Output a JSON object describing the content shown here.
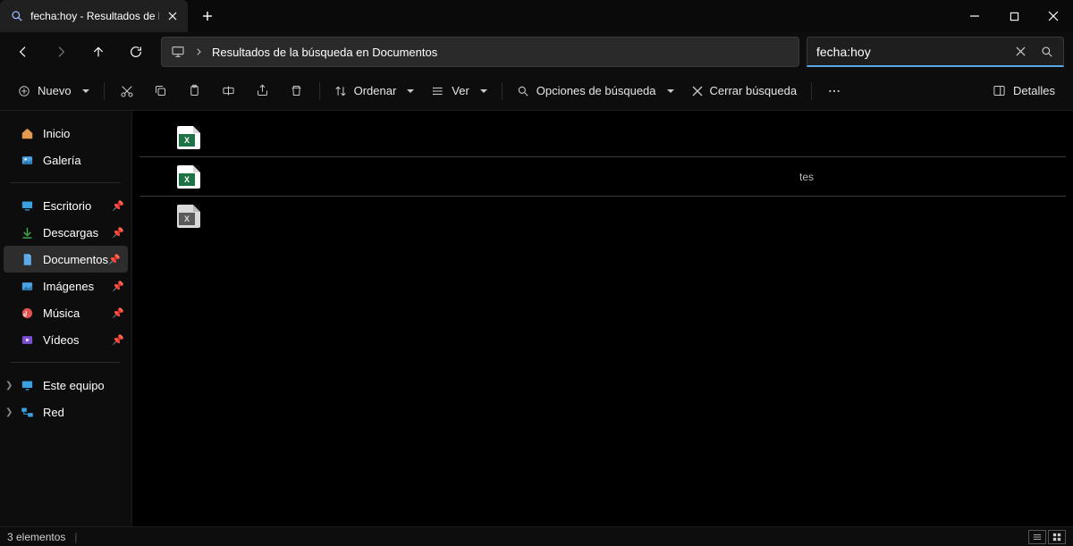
{
  "titlebar": {
    "tab_title": "fecha:hoy - Resultados de la b"
  },
  "addressbar": {
    "crumb": "Resultados de la búsqueda en Documentos"
  },
  "search": {
    "value": "fecha:hoy"
  },
  "toolbar": {
    "new_label": "Nuevo",
    "sort_label": "Ordenar",
    "view_label": "Ver",
    "search_options_label": "Opciones de búsqueda",
    "close_search_label": "Cerrar búsqueda",
    "details_label": "Detalles"
  },
  "sidebar": {
    "home": "Inicio",
    "gallery": "Galería",
    "pinned": [
      {
        "label": "Escritorio"
      },
      {
        "label": "Descargas"
      },
      {
        "label": "Documentos"
      },
      {
        "label": "Imágenes"
      },
      {
        "label": "Música"
      },
      {
        "label": "Vídeos"
      }
    ],
    "this_pc": "Este equipo",
    "network": "Red"
  },
  "files": [
    {
      "name": "",
      "type": "xlsx",
      "meta": ""
    },
    {
      "name": "",
      "type": "xlsx",
      "meta": "tes"
    },
    {
      "name": "",
      "type": "xlsx-locked",
      "meta": ""
    }
  ],
  "statusbar": {
    "count_label": "3 elementos"
  }
}
